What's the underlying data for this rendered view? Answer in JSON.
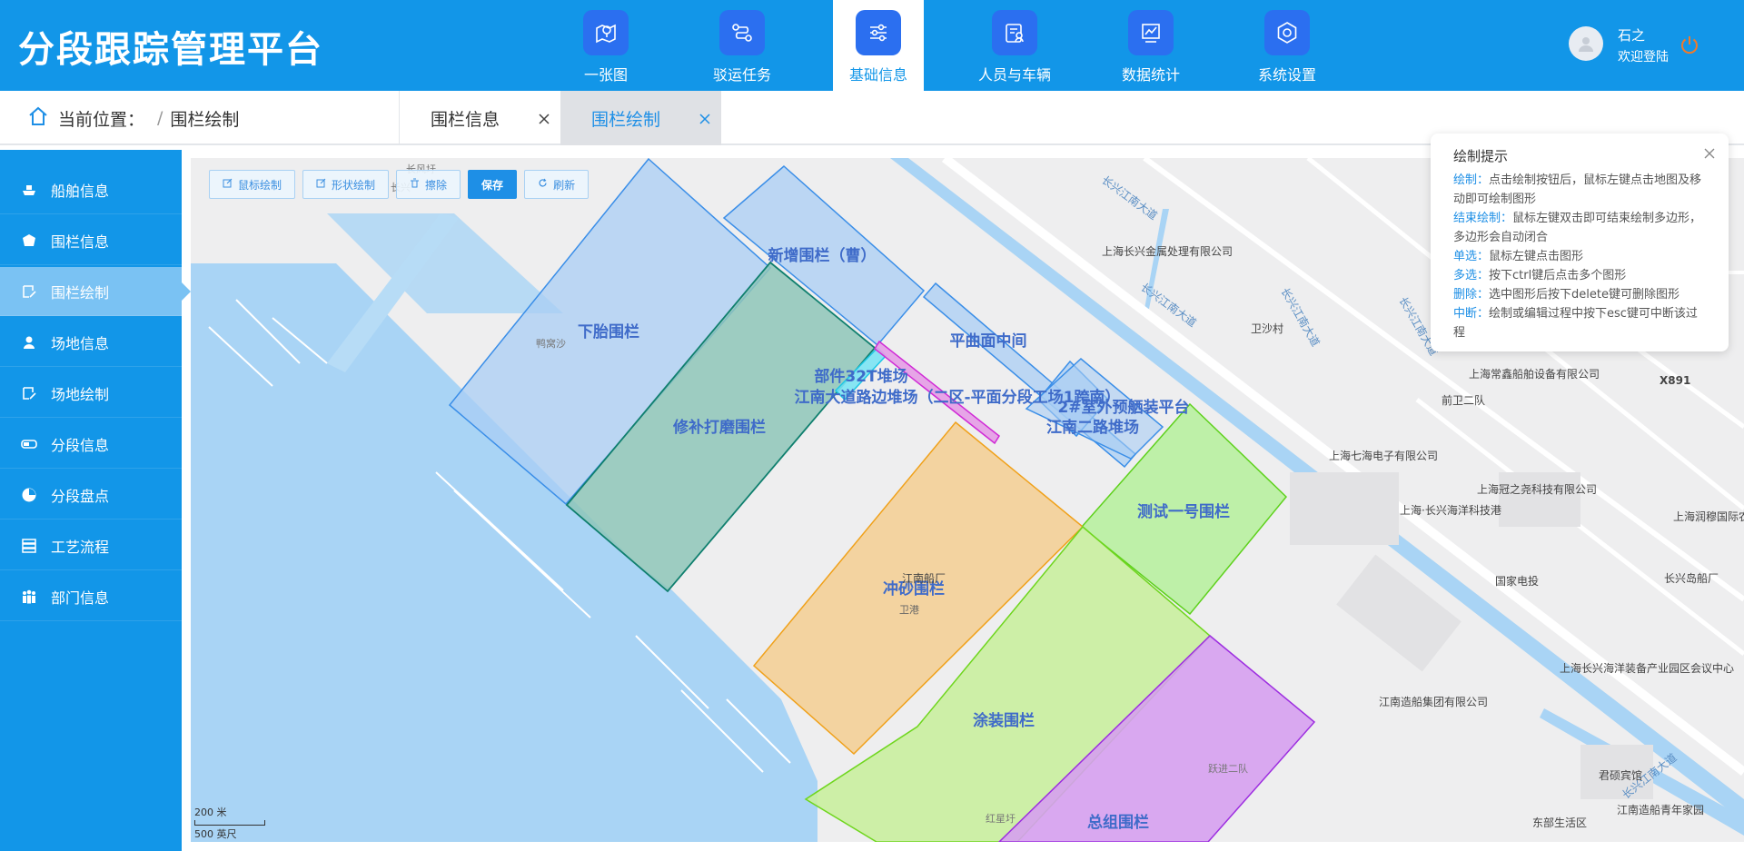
{
  "app": {
    "title": "分段跟踪管理平台"
  },
  "nav": [
    {
      "label": "一张图",
      "icon": "map-pin-icon"
    },
    {
      "label": "驳运任务",
      "icon": "route-icon"
    },
    {
      "label": "基础信息",
      "icon": "sliders-icon",
      "active": true
    },
    {
      "label": "人员与车辆",
      "icon": "person-card-icon"
    },
    {
      "label": "数据统计",
      "icon": "chart-icon"
    },
    {
      "label": "系统设置",
      "icon": "hexagon-gear-icon"
    }
  ],
  "user": {
    "name": "石之",
    "welcome": "欢迎登陆"
  },
  "breadcrumb": {
    "prefix": "当前位置：",
    "separator": "/",
    "current": "围栏绘制"
  },
  "tabs": [
    {
      "label": "围栏信息"
    },
    {
      "label": "围栏绘制",
      "active": true
    }
  ],
  "sidebar": {
    "items": [
      {
        "label": "船舶信息",
        "icon": "ship-icon"
      },
      {
        "label": "围栏信息",
        "icon": "fence-icon"
      },
      {
        "label": "围栏绘制",
        "icon": "draw-fence-icon",
        "active": true
      },
      {
        "label": "场地信息",
        "icon": "site-icon"
      },
      {
        "label": "场地绘制",
        "icon": "draw-site-icon"
      },
      {
        "label": "分段信息",
        "icon": "segment-icon"
      },
      {
        "label": "分段盘点",
        "icon": "inventory-icon"
      },
      {
        "label": "工艺流程",
        "icon": "process-icon"
      },
      {
        "label": "部门信息",
        "icon": "department-icon"
      }
    ]
  },
  "toolbar": {
    "mouse_draw": "鼠标绘制",
    "shape_draw": "形状绘制",
    "erase": "擦除",
    "save": "保存",
    "refresh": "刷新"
  },
  "hint": {
    "title": "绘制提示",
    "lines": [
      {
        "key": "绘制：",
        "text": "点击绘制按钮后，鼠标左键点击地图及移动即可绘制图形"
      },
      {
        "key": "结束绘制：",
        "text": "鼠标左键双击即可结束绘制多边形，多边形会自动闭合"
      },
      {
        "key": "单选：",
        "text": "鼠标左键点击图形"
      },
      {
        "key": "多选：",
        "text": "按下ctrl键后点击多个图形"
      },
      {
        "key": "删除：",
        "text": "选中图形后按下delete键可删除图形"
      },
      {
        "key": "中断：",
        "text": "绘制或编辑过程中按下esc键可中断该过程"
      }
    ]
  },
  "fences": [
    {
      "label": "下胎围栏",
      "color": "#3a8ee8",
      "fill": "#a9cdf4"
    },
    {
      "label": "新增围栏（曹）",
      "color": "#3a8ee8",
      "fill": "#a9cdf4"
    },
    {
      "label": "修补打磨围栏",
      "color": "#0f7f6e",
      "fill": "#8ec6b9"
    },
    {
      "label": "平曲面中间",
      "color": "#3a8ee8",
      "fill": "#a9cdf4"
    },
    {
      "label": "部件32T堆场",
      "color": "#1ec8e6",
      "fill": "#7be3f3"
    },
    {
      "label": "江南大道路边堆场（二区-平面分段工场1跨南）",
      "color": "#d02ad6",
      "fill": "#e49ce6"
    },
    {
      "label": "2#室外预舾装平台",
      "color": "#3a8ee8",
      "fill": "#a9cdf4"
    },
    {
      "label": "江南二路堆场",
      "color": "#3a8ee8",
      "fill": "#a9cdf4"
    },
    {
      "label": "测试一号围栏",
      "color": "#5ed11c",
      "fill": "#b8f0a0"
    },
    {
      "label": "冲砂围栏",
      "color": "#f0a11a",
      "fill": "#f3cf97"
    },
    {
      "label": "涂装围栏",
      "color": "#6fd61e",
      "fill": "#c9ee9e"
    },
    {
      "label": "总组围栏",
      "color": "#9d2ee0",
      "fill": "#d6a0ef"
    }
  ],
  "map_labels": [
    "长兴江南大道",
    "长兴江南大道",
    "长兴江南大道",
    "长兴江南大道",
    "长兴江南大道",
    "上海长兴金属处理有限公司",
    "卫沙村",
    "上海常鑫船舶设备有限公司",
    "X891",
    "前卫二队",
    "上海七海电子有限公司",
    "上海冠之尧科技有限公司",
    "上海·长兴海洋科技港",
    "国家电投",
    "长兴岛船厂",
    "上海润穆国际农产品交易中",
    "上海长兴海洋装备产业园区会议中心",
    "江南造船集团有限公司",
    "君硕宾馆",
    "东部生活区",
    "江南造船青年家园",
    "江南船厂",
    "卫港",
    "鸭窝沙",
    "红星圩",
    "跃进二队",
    "长风圩",
    "长兴"
  ],
  "scale": {
    "m": "200 米",
    "ft": "500 英尺"
  }
}
